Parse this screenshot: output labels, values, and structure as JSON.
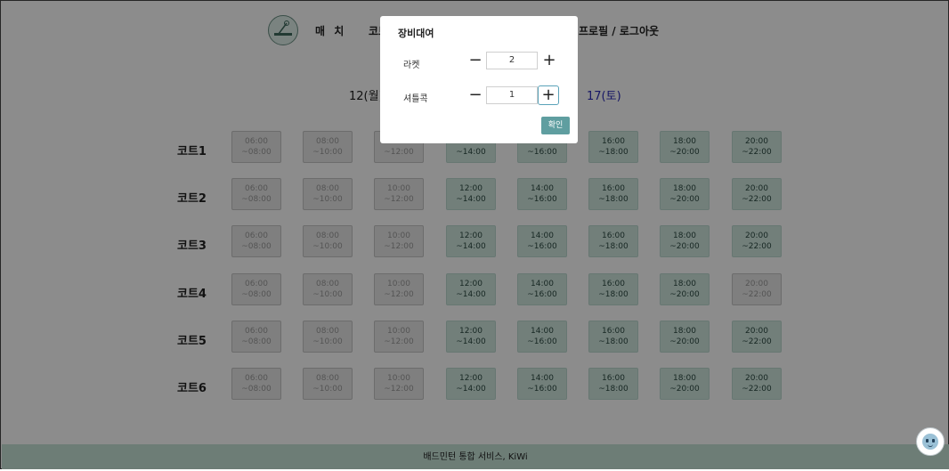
{
  "header": {
    "nav": {
      "match": "매 치",
      "court": "코트",
      "profile_logout": "프로필 / 로그아웃"
    }
  },
  "dates": {
    "first": "12(월)",
    "last": "17(토)"
  },
  "courts": [
    "코트1",
    "코트2",
    "코트3",
    "코트4",
    "코트5",
    "코트6"
  ],
  "time_slots": [
    {
      "start": "06:00",
      "end": "~08:00"
    },
    {
      "start": "08:00",
      "end": "~10:00"
    },
    {
      "start": "10:00",
      "end": "~12:00"
    },
    {
      "start": "12:00",
      "end": "~14:00"
    },
    {
      "start": "14:00",
      "end": "~16:00"
    },
    {
      "start": "16:00",
      "end": "~18:00"
    },
    {
      "start": "18:00",
      "end": "~20:00"
    },
    {
      "start": "20:00",
      "end": "~22:00"
    }
  ],
  "availability": [
    [
      false,
      false,
      false,
      true,
      true,
      true,
      true,
      true
    ],
    [
      false,
      false,
      false,
      true,
      true,
      true,
      true,
      true
    ],
    [
      false,
      false,
      false,
      true,
      true,
      true,
      true,
      true
    ],
    [
      false,
      false,
      false,
      true,
      true,
      true,
      true,
      false
    ],
    [
      false,
      false,
      false,
      true,
      true,
      true,
      true,
      true
    ],
    [
      false,
      false,
      false,
      true,
      true,
      true,
      true,
      true
    ]
  ],
  "modal": {
    "title": "장비대여",
    "racket": {
      "label": "라켓",
      "value": "2"
    },
    "shuttlecock": {
      "label": "셔틀콕",
      "value": "1"
    },
    "minus_symbol": "−",
    "plus_symbol": "+",
    "confirm_label": "확인"
  },
  "footer": {
    "text": "배드민턴 통합 서비스, KiWi"
  },
  "colors": {
    "available_slot": "#cfe7df",
    "unavailable_slot": "#e7e7e7",
    "footer_bg": "#c6e3d8",
    "confirm_button": "#5f9ea0",
    "date_highlight": "#2a2ab8"
  },
  "icons": {
    "logo": "badminton-logo-icon",
    "chat": "chatbot-face-icon"
  }
}
